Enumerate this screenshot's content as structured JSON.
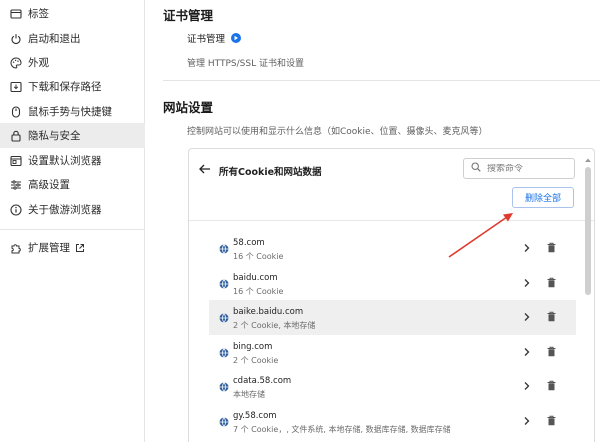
{
  "sidebar": {
    "items": [
      {
        "label": "标签",
        "icon": "tab-icon"
      },
      {
        "label": "启动和退出",
        "icon": "power-icon"
      },
      {
        "label": "外观",
        "icon": "palette-icon"
      },
      {
        "label": "下载和保存路径",
        "icon": "download-icon"
      },
      {
        "label": "鼠标手势与快捷键",
        "icon": "mouse-icon"
      },
      {
        "label": "隐私与安全",
        "icon": "lock-icon",
        "active": true
      },
      {
        "label": "设置默认浏览器",
        "icon": "browser-icon"
      },
      {
        "label": "高级设置",
        "icon": "sliders-icon"
      },
      {
        "label": "关于傲游浏览器",
        "icon": "info-icon"
      }
    ],
    "extensions_label": "扩展管理"
  },
  "cert": {
    "title": "证书管理",
    "row_label": "证书管理",
    "desc": "管理 HTTPS/SSL 证书和设置"
  },
  "site_settings": {
    "title": "网站设置",
    "desc": "控制网站可以使用和显示什么信息（如Cookie、位置、摄像头、麦克风等）"
  },
  "dialog": {
    "title": "所有Cookie和网站数据",
    "search_placeholder": "搜索命令",
    "remove_all": "删除全部",
    "sites": [
      {
        "name": "58.com",
        "info": "16 个 Cookie"
      },
      {
        "name": "baidu.com",
        "info": "16 个 Cookie"
      },
      {
        "name": "baike.baidu.com",
        "info": "2 个 Cookie, 本地存储",
        "hover": true
      },
      {
        "name": "bing.com",
        "info": "2 个 Cookie"
      },
      {
        "name": "cdata.58.com",
        "info": "本地存储"
      },
      {
        "name": "gy.58.com",
        "info": "7 个 Cookie，, 文件系统, 本地存储, 数据库存储, 数据库存储"
      }
    ]
  },
  "colors": {
    "accent": "#1a73e8",
    "annotation": "#e03a2f",
    "active_bg": "#ececec"
  }
}
